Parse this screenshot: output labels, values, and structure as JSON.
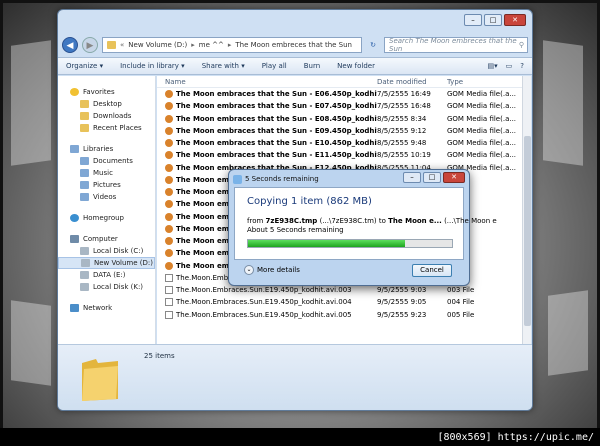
{
  "window": {
    "address": [
      "New Volume (D:)",
      "me ^^",
      "The Moon embreces that the Sun"
    ],
    "search_placeholder": "Search The Moon embreces that the Sun",
    "controls": {
      "minimize": "–",
      "maximize": "□",
      "close": "✕"
    }
  },
  "toolbar": {
    "organize": "Organize ▾",
    "include": "Include in library ▾",
    "share": "Share with ▾",
    "play": "Play all",
    "burn": "Burn",
    "new_folder": "New folder"
  },
  "sidebar": {
    "favorites": {
      "label": "Favorites",
      "items": [
        "Desktop",
        "Downloads",
        "Recent Places"
      ]
    },
    "libraries": {
      "label": "Libraries",
      "items": [
        "Documents",
        "Music",
        "Pictures",
        "Videos"
      ]
    },
    "homegroup": "Homegroup",
    "computer": {
      "label": "Computer",
      "items": [
        "Local Disk (C:)",
        "New Volume (D:)",
        "DATA (E:)",
        "Local Disk (K:)"
      ]
    },
    "network": "Network"
  },
  "columns": {
    "name": "Name",
    "date": "Date modified",
    "type": "Type"
  },
  "files": [
    {
      "name": "The Moon embraces that the Sun - E06.450p_kodhit.avi",
      "date": "7/5/2555 16:49",
      "type": "GOM Media file(.a..."
    },
    {
      "name": "The Moon embraces that the Sun - E07.450p_kodhit.avi",
      "date": "7/5/2555 16:48",
      "type": "GOM Media file(.a..."
    },
    {
      "name": "The Moon embraces that the Sun - E08.450p_kodhit.avi",
      "date": "8/5/2555 8:34",
      "type": "GOM Media file(.a..."
    },
    {
      "name": "The Moon embraces that the Sun - E09.450p_kodhit.avi",
      "date": "8/5/2555 9:12",
      "type": "GOM Media file(.a..."
    },
    {
      "name": "The Moon embraces that the Sun - E10.450p_kodhit.avi",
      "date": "8/5/2555 9:48",
      "type": "GOM Media file(.a..."
    },
    {
      "name": "The Moon embraces that the Sun - E11.450p_kodhit.avi",
      "date": "8/5/2555 10:19",
      "type": "GOM Media file(.a..."
    },
    {
      "name": "The Moon embraces that the Sun - E12.450p_kodhit.avi",
      "date": "8/5/2555 11:04",
      "type": "GOM Media file(.a..."
    },
    {
      "name": "The Moon embra",
      "date": "",
      "type": "a..."
    },
    {
      "name": "The Moon embra",
      "date": "",
      "type": "a..."
    },
    {
      "name": "The Moon embra",
      "date": "",
      "type": "a..."
    },
    {
      "name": "The Moon embra",
      "date": "",
      "type": "a..."
    },
    {
      "name": "The Moon embra",
      "date": "",
      "type": "a..."
    },
    {
      "name": "The Moon embra",
      "date": "",
      "type": "a..."
    },
    {
      "name": "The Moon embra",
      "date": "",
      "type": "a..."
    },
    {
      "name": "The Moon embra",
      "date": "",
      "type": "a..."
    },
    {
      "name": "The.Moon.Embra",
      "date": "",
      "type": ""
    },
    {
      "name": "The.Moon.Embraces.Sun.E19.450p_kodhit.avi.003",
      "date": "9/5/2555 9:03",
      "type": "003 File"
    },
    {
      "name": "The.Moon.Embraces.Sun.E19.450p_kodhit.avi.004",
      "date": "9/5/2555 9:05",
      "type": "004 File"
    },
    {
      "name": "The.Moon.Embraces.Sun.E19.450p_kodhit.avi.005",
      "date": "9/5/2555 9:23",
      "type": "005 File"
    }
  ],
  "details": {
    "count": "25 items"
  },
  "dialog": {
    "title": "5 Seconds remaining",
    "heading": "Copying 1 item (862 MB)",
    "from_label": "from",
    "from_file": "7zE938C.tmp",
    "from_path": "(...\\7zE938C.tm)",
    "to_label": "to",
    "to_name": "The Moon e...",
    "to_path": "(...\\The Moon e",
    "remaining": "About 5 Seconds remaining",
    "progress": 0.77,
    "more_details": "More details",
    "cancel": "Cancel"
  },
  "watermark": "[800x569] https://upic.me/"
}
